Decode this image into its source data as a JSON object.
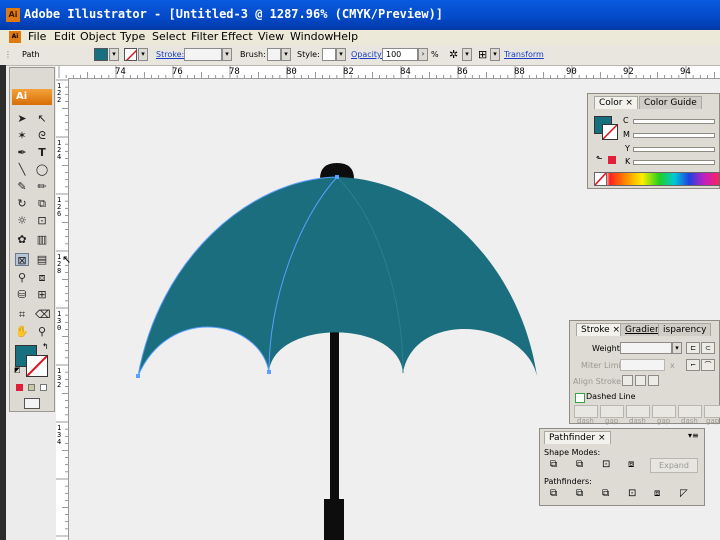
{
  "window": {
    "title": "Adobe Illustrator - [Untitled-3 @ 1287.96% (CMYK/Preview)]",
    "app_icon": "Ai"
  },
  "menu": [
    "File",
    "Edit",
    "Object",
    "Type",
    "Select",
    "Filter",
    "Effect",
    "View",
    "Window",
    "Help"
  ],
  "control_bar": {
    "selection": "Path",
    "stroke_label": "Stroke:",
    "brush_label": "Brush:",
    "style_label": "Style:",
    "opacity_label": "Opacity:",
    "opacity_value": "100",
    "opacity_unit": "%",
    "transform_label": "Transform",
    "fill_color": "#177080"
  },
  "ruler": {
    "h_ticks": [
      "74",
      "76",
      "78",
      "80",
      "82",
      "84",
      "86",
      "88",
      "90",
      "92",
      "94"
    ],
    "v_ticks": [
      "1\n2\n2",
      "1\n2\n4",
      "1\n2\n6",
      "1\n2\n8",
      "1\n3\n0",
      "1\n3\n2",
      "1\n3\n4"
    ]
  },
  "toolbox": {
    "badge": "Ai"
  },
  "color_panel": {
    "tabs": [
      "Color",
      "Color Guide"
    ],
    "channels": [
      "C",
      "M",
      "Y",
      "K"
    ],
    "fill_color": "#177080"
  },
  "stroke_panel": {
    "tabs": [
      "Stroke",
      "Gradient",
      "Transparency"
    ],
    "tab_display": [
      "Stroke",
      "Gradient",
      "isparency"
    ],
    "weight_label": "Weight:",
    "miter_label": "Miter Limit:",
    "miter_suffix": "x",
    "align_label": "Align Stroke:",
    "dashed_label": "Dashed Line",
    "dash_labels": [
      "dash",
      "gap",
      "dash",
      "gap",
      "dash",
      "gap"
    ]
  },
  "pathfinder_panel": {
    "tab": "Pathfinder",
    "shape_modes_label": "Shape Modes:",
    "expand_label": "Expand",
    "pathfinders_label": "Pathfinders:"
  },
  "artwork": {
    "canopy_color": "#1a6e7e",
    "handle_color": "#0d0d0d"
  }
}
